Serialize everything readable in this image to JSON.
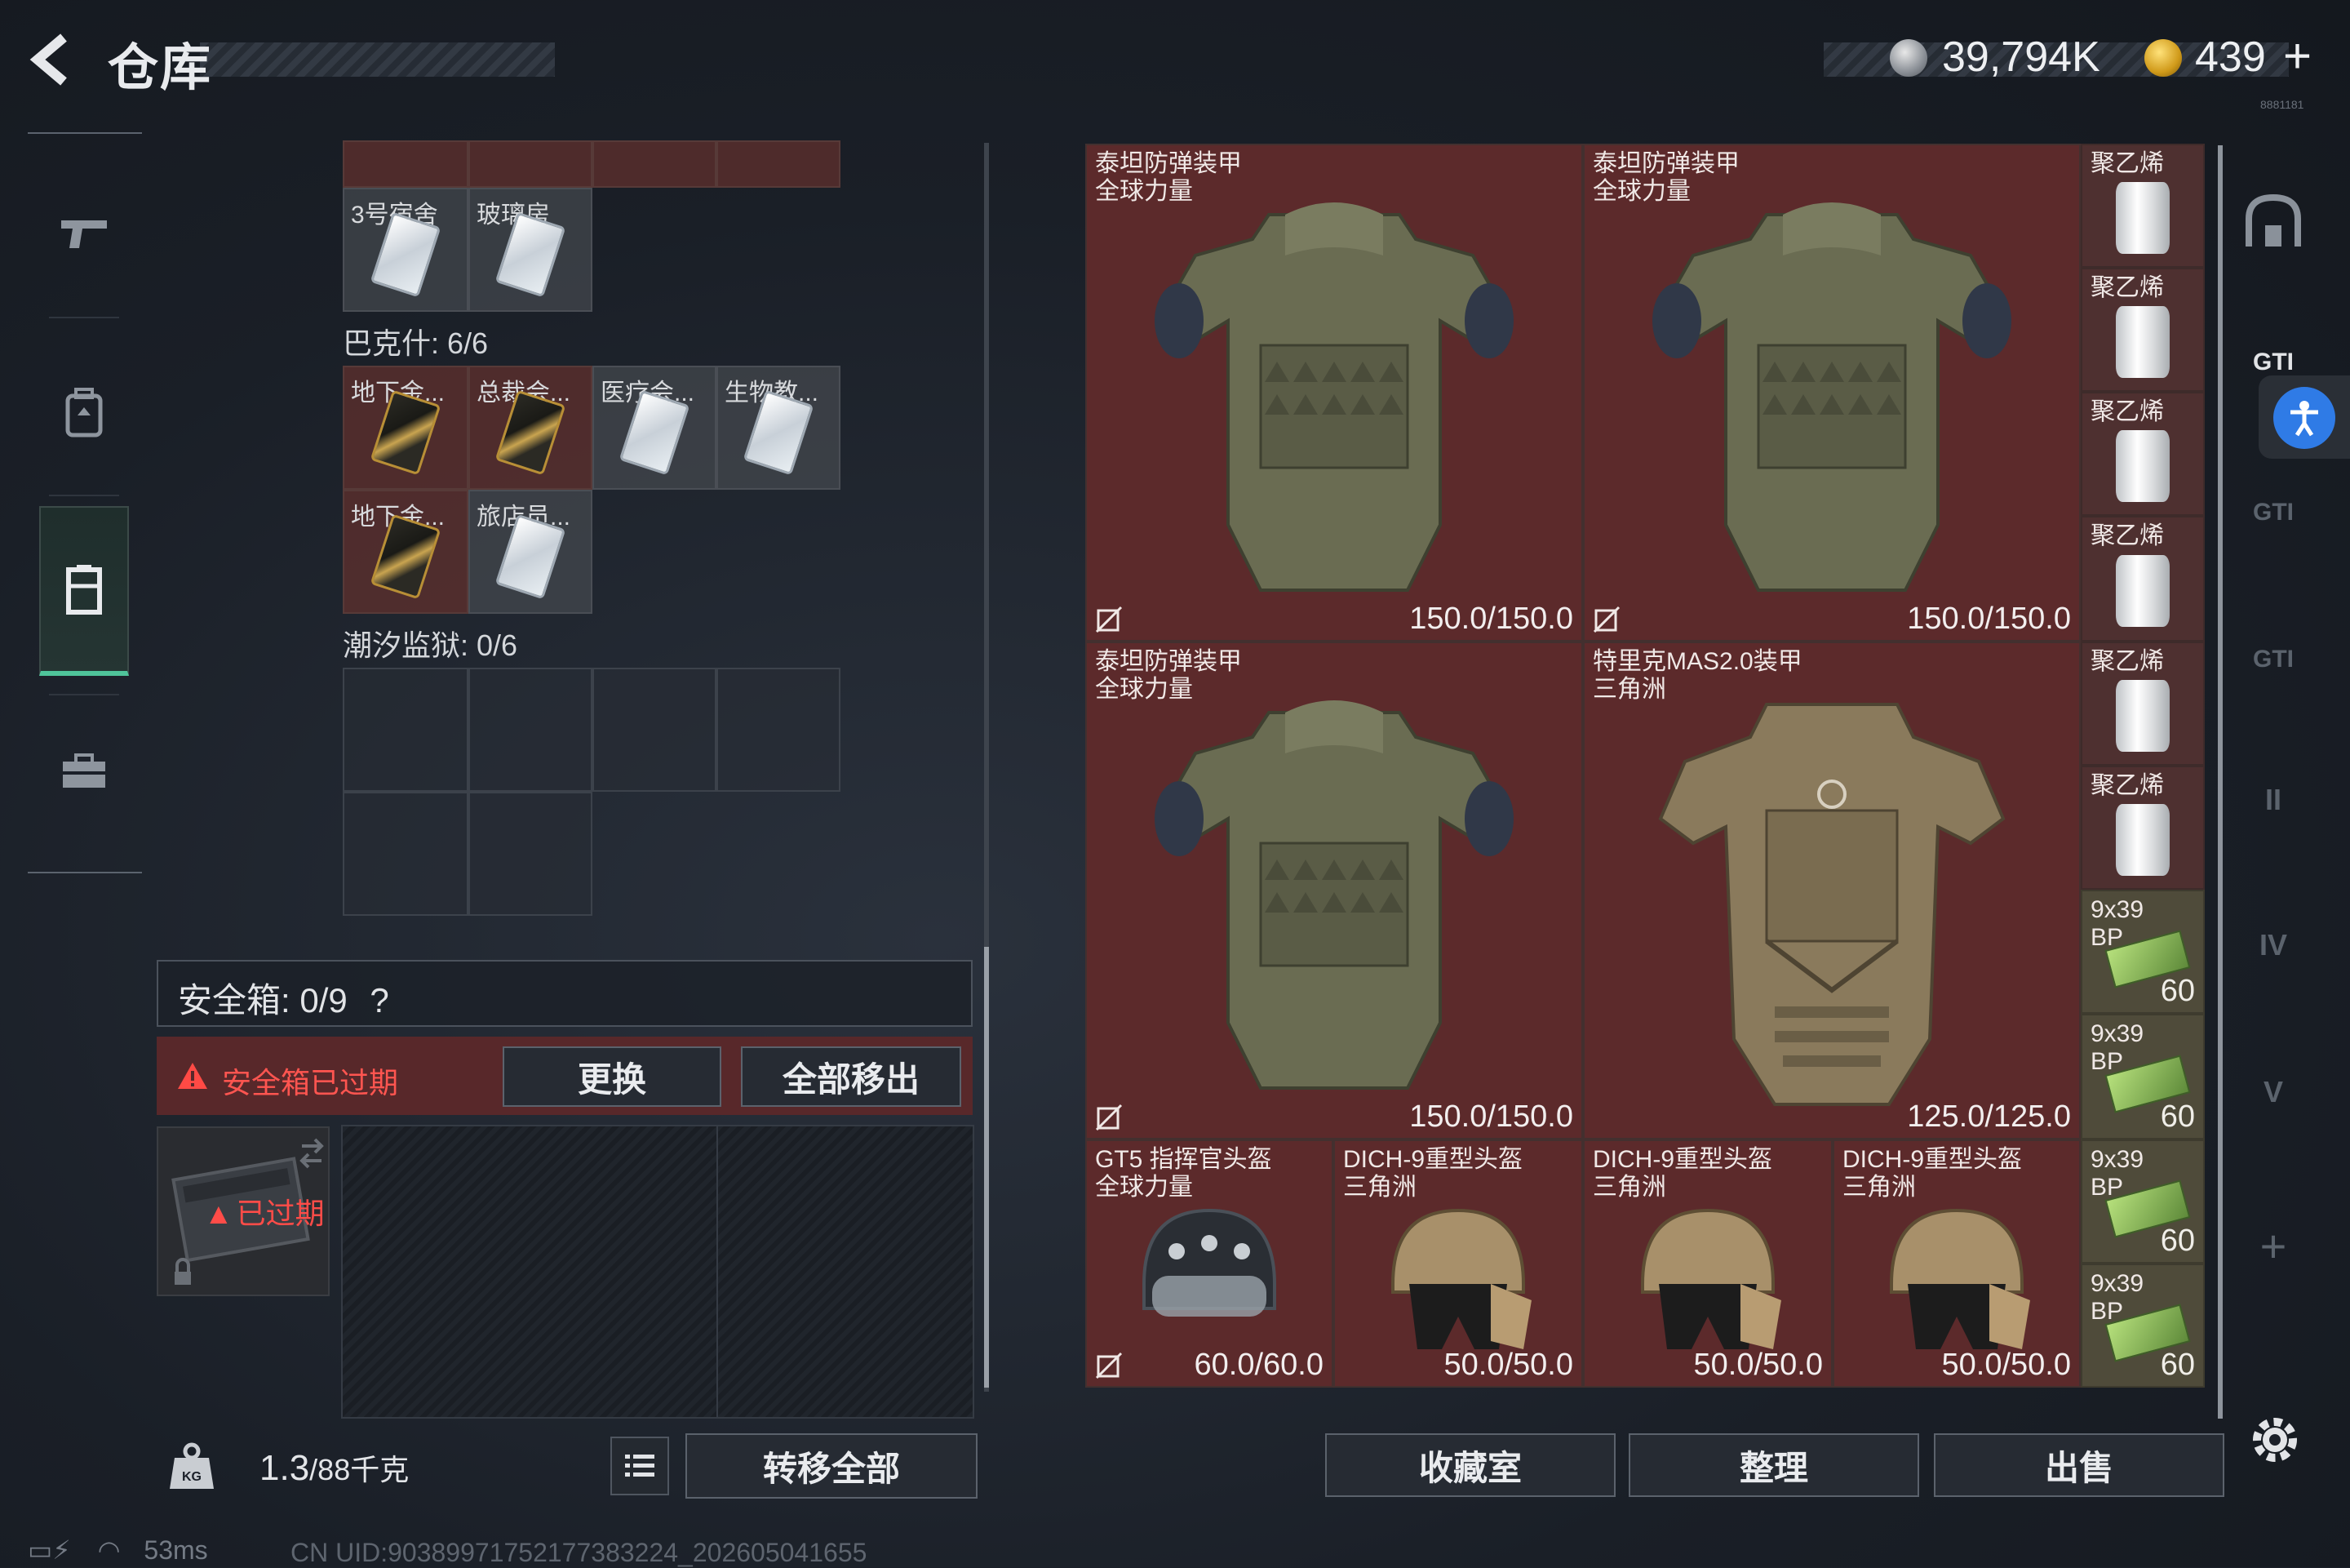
{
  "header": {
    "title": "仓库",
    "currency_silver": "39,794K",
    "currency_gold": "439",
    "plus_label": "+",
    "tiny_build": "8881181"
  },
  "left_rail": {
    "items": [
      {
        "icon": "gun-icon"
      },
      {
        "icon": "backpack-icon"
      },
      {
        "icon": "vest-icon"
      },
      {
        "icon": "toolbox-icon"
      }
    ]
  },
  "keys": {
    "top_row_labels": [
      "3号宿舍",
      "玻璃房"
    ],
    "section1_label": "巴克什: 6/6",
    "section1_items": [
      "地下金...",
      "总裁会...",
      "医疗会...",
      "生物教...",
      "地下金...",
      "旅店员..."
    ],
    "section2_label": "潮汐监狱: 0/6"
  },
  "safe": {
    "label": "安全箱:  0/9",
    "help": "?",
    "warning": "安全箱已过期",
    "swap_label": "更换",
    "move_all_label": "全部移出",
    "expired_label": "已过期"
  },
  "footer_left": {
    "weight": "1.3",
    "weight_cap": "/88千克",
    "transfer_all_label": "转移全部",
    "ping": "53ms",
    "uid": "CN UID:9038997175217738322​4_202605041655"
  },
  "stash": {
    "armor": [
      {
        "name": "泰坦防弹装甲",
        "sub": "全球力量",
        "durability": "150.0/150.0"
      },
      {
        "name": "泰坦防弹装甲",
        "sub": "全球力量",
        "durability": "150.0/150.0"
      },
      {
        "name": "泰坦防弹装甲",
        "sub": "全球力量",
        "durability": "150.0/150.0"
      },
      {
        "name": "特里克MAS2.0装甲",
        "sub": "三角洲",
        "durability": "125.0/125.0"
      }
    ],
    "helmets": [
      {
        "name": "GT5 指挥官头盔",
        "sub": "全球力量",
        "durability": "60.0/60.0"
      },
      {
        "name": "DICH-9重型头盔",
        "sub": "三角洲",
        "durability": "50.0/50.0"
      },
      {
        "name": "DICH-9重型头盔",
        "sub": "三角洲",
        "durability": "50.0/50.0"
      },
      {
        "name": "DICH-9重型头盔",
        "sub": "三角洲",
        "durability": "50.0/50.0"
      }
    ],
    "poly": [
      "聚乙烯",
      "聚乙烯",
      "聚乙烯",
      "聚乙烯",
      "聚乙烯",
      "聚乙烯"
    ],
    "ammo": [
      {
        "name": "9x39",
        "sub": "BP",
        "qty": "60"
      },
      {
        "name": "9x39",
        "sub": "BP",
        "qty": "60"
      },
      {
        "name": "9x39",
        "sub": "BP",
        "qty": "60"
      },
      {
        "name": "9x39",
        "sub": "BP",
        "qty": "60"
      }
    ]
  },
  "right_rail": {
    "items": [
      "GTI",
      "GTI",
      "GTI",
      "II",
      "IV",
      "V",
      "+"
    ]
  },
  "footer_right": {
    "collect_label": "收藏室",
    "sort_label": "整理",
    "sell_label": "出售"
  }
}
